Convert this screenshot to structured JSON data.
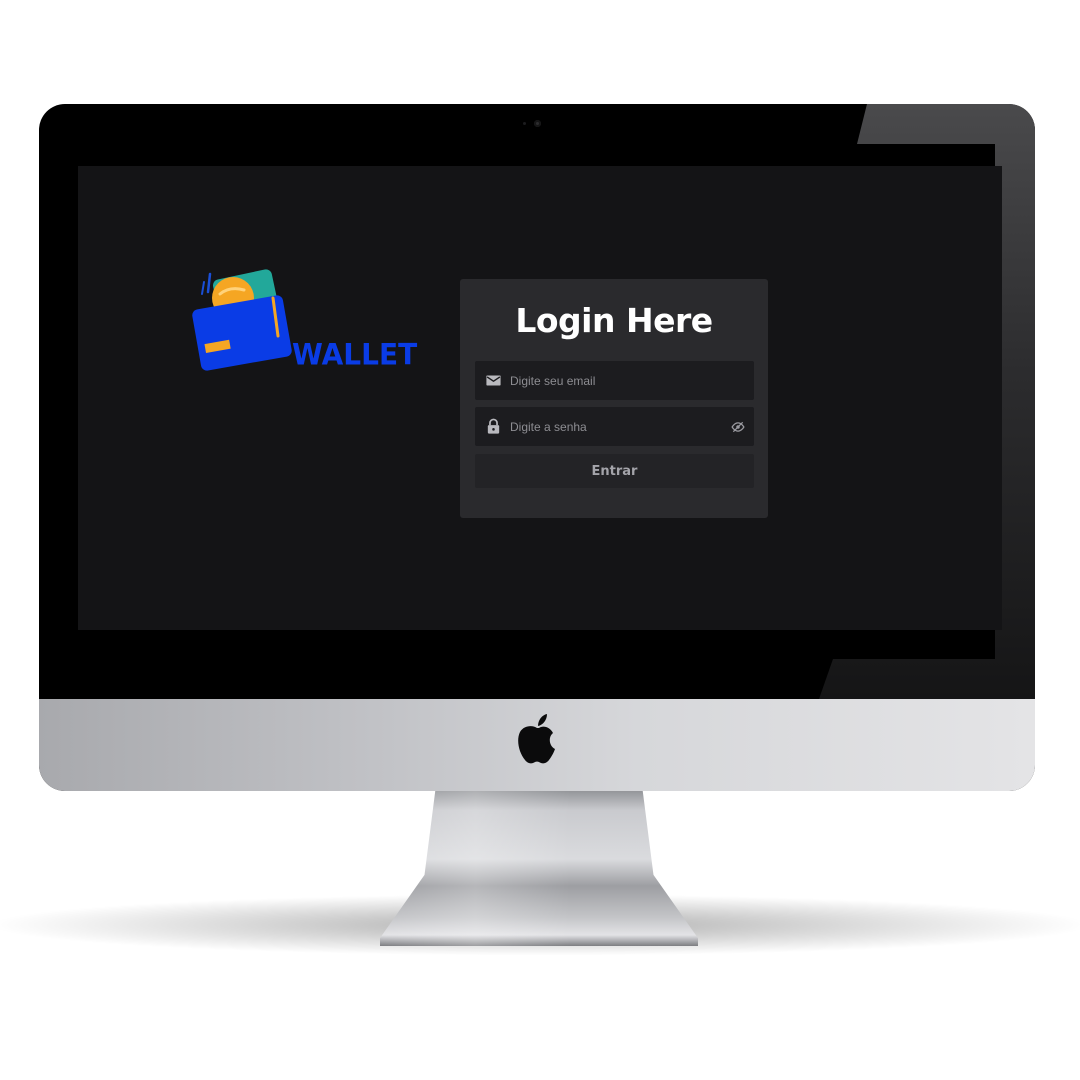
{
  "brand": {
    "name": "WALLET"
  },
  "login": {
    "title": "Login Here",
    "email_placeholder": "Digite seu email",
    "password_placeholder": "Digite a senha",
    "submit_label": "Entrar"
  },
  "icons": {
    "email": "envelope-icon",
    "password": "lock-icon",
    "toggle_visibility": "eye-slash-icon",
    "brand": "wallet-icon",
    "device_logo": "apple-logo-icon"
  },
  "colors": {
    "screen_background": "#141416",
    "card_background": "#2a2a2d",
    "input_background": "#1c1c1f",
    "brand_blue": "#0a3ce6",
    "title_text": "#ffffff",
    "placeholder_text": "#8d8d92",
    "button_text": "#a4a4aa"
  }
}
